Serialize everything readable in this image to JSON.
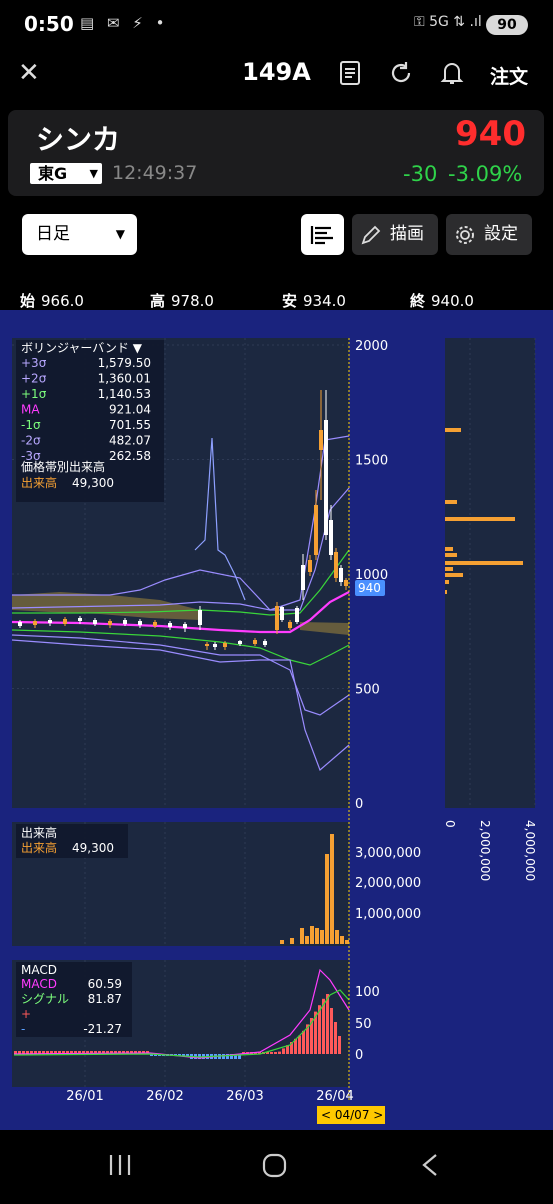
{
  "status_bar": {
    "time": "0:50",
    "left_icons": "▤ ✉ ⚡ •",
    "right_icons": "⚿ 5G ⇅ .ıl",
    "battery": "90"
  },
  "header": {
    "title": "149A",
    "order_label": "注文"
  },
  "stock": {
    "name": "シンカ",
    "price": "940",
    "market": "東G",
    "time": "12:49:37",
    "change": "-30",
    "change_pct": "-3.09%"
  },
  "controls": {
    "period": "日足",
    "draw_label": "描画",
    "settings_label": "設定"
  },
  "ohlc": [
    {
      "label": "始",
      "value": "966.0"
    },
    {
      "label": "高",
      "value": "978.0"
    },
    {
      "label": "安",
      "value": "934.0"
    },
    {
      "label": "終",
      "value": "940.0"
    }
  ],
  "legend": {
    "title": "ボリンジャーバンド ▼",
    "rows": [
      {
        "name": "+3σ",
        "value": "1,579.50",
        "color": "#b8a8ff"
      },
      {
        "name": "+2σ",
        "value": "1,360.01",
        "color": "#b8a8ff"
      },
      {
        "name": "+1σ",
        "value": "1,140.53",
        "color": "#7dff7d"
      },
      {
        "name": "MA",
        "value": "921.04",
        "color": "#ff3cff"
      },
      {
        "name": "-1σ",
        "value": "701.55",
        "color": "#7dff7d"
      },
      {
        "name": "-2σ",
        "value": "482.07",
        "color": "#b8a8ff"
      },
      {
        "name": "-3σ",
        "value": "262.58",
        "color": "#b8a8ff"
      }
    ],
    "extra_title": "価格帯別出来高",
    "volume_label": "出来高",
    "volume_value": "49,300"
  },
  "volume_panel": {
    "title": "出来高",
    "label": "出来高",
    "value": "49,300",
    "ticks": [
      "3,000,000",
      "2,000,000",
      "1,000,000"
    ]
  },
  "macd_panel": {
    "title": "MACD",
    "rows": [
      {
        "name": "MACD",
        "value": "60.59",
        "color": "#ff3cff"
      },
      {
        "name": "シグナル",
        "value": "81.87",
        "color": "#7dff7d"
      },
      {
        "name": "+",
        "value": "",
        "color": "#ff5a5a"
      },
      {
        "name": "-",
        "value": "-21.27",
        "color": "#5aa0ff"
      }
    ],
    "ticks": [
      "100",
      "50",
      "0"
    ]
  },
  "price_axis": [
    "2000",
    "1500",
    "1000",
    "500",
    "0"
  ],
  "current_price_tag": "940",
  "volume_profile_axis": [
    "0",
    "2,000,000",
    "4,000,000"
  ],
  "x_axis": [
    "26/01",
    "26/02",
    "26/03",
    "26/04"
  ],
  "date_badge": "< 04/07 >",
  "chart_data": {
    "type": "candlestick",
    "ylim": [
      0,
      2000
    ],
    "current": 940,
    "bollinger": {
      "+3σ": 1579.5,
      "+2σ": 1360.01,
      "+1σ": 1140.53,
      "MA": 921.04,
      "-1σ": 701.55,
      "-2σ": 482.07,
      "-3σ": 262.58
    },
    "volume_last": 49300,
    "macd": {
      "MACD": 60.59,
      "signal": 81.87,
      "hist": -21.27
    }
  },
  "colors": {
    "chart_bg": "#1a237e",
    "up": "#ffffff",
    "down": "#f5a033",
    "price_red": "#ff2d2d",
    "change_green": "#2fd34a",
    "tag_blue": "#4a90ff",
    "badge_yellow": "#ffc800"
  }
}
